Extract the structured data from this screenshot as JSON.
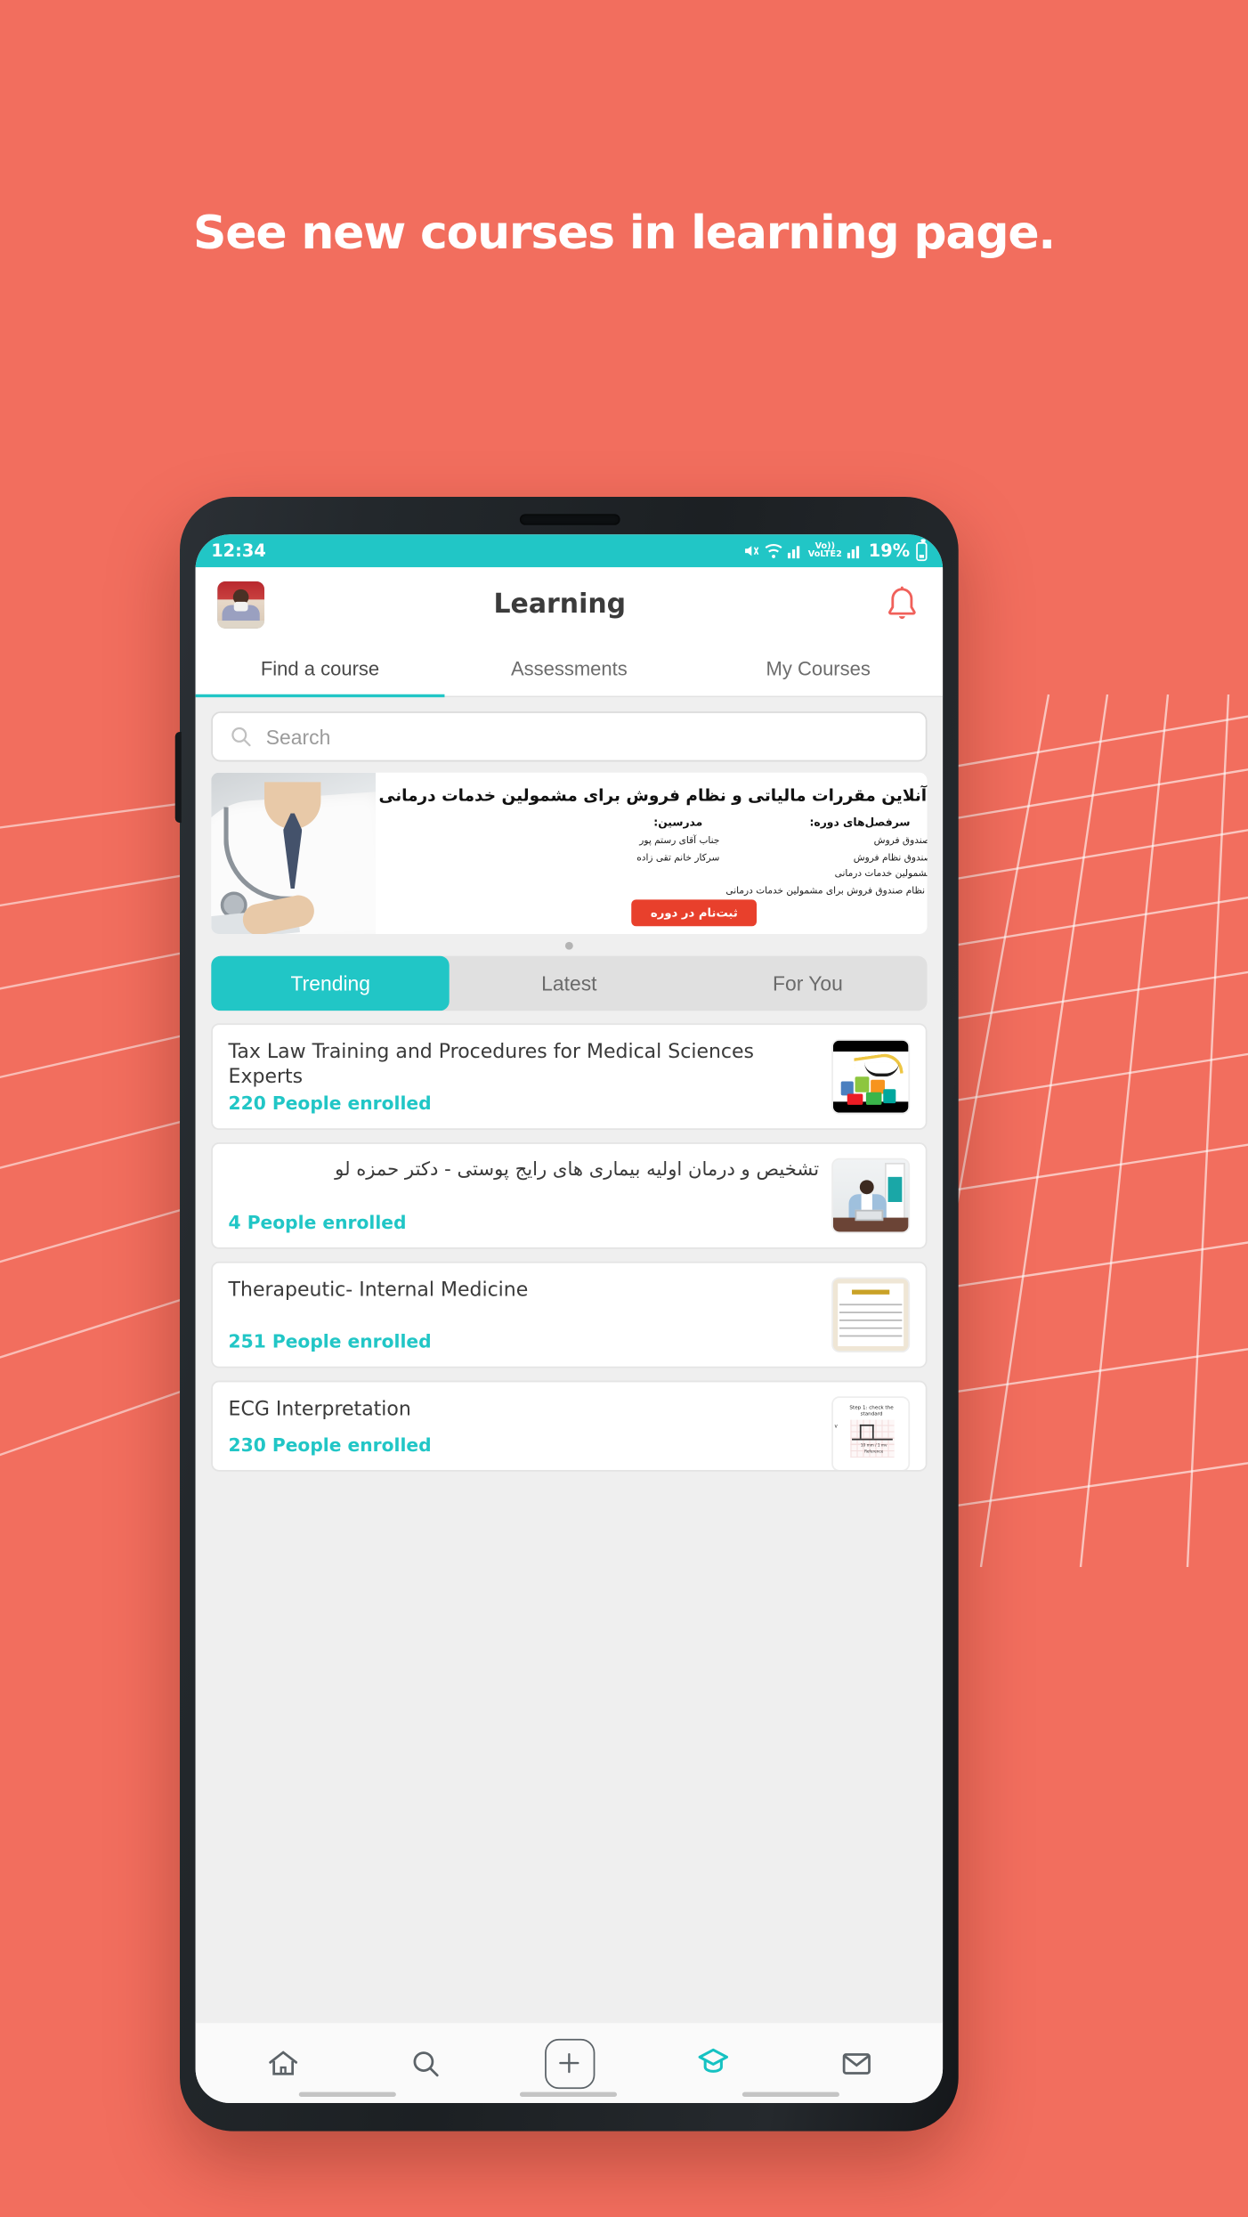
{
  "promo": {
    "headline": "See new courses in learning page.",
    "background_color": "#F26E5E",
    "accent_color": "#21C6C6"
  },
  "status_bar": {
    "time": "12:34",
    "network_label": "VoLTE2",
    "battery_percent": "19%",
    "icons": [
      "mute-icon",
      "wifi-icon",
      "signal-icon",
      "volte-icon",
      "signal-icon",
      "battery-icon"
    ]
  },
  "app_bar": {
    "title": "Learning",
    "avatar": "user-avatar",
    "notification_icon": "bell-icon"
  },
  "top_tabs": [
    {
      "label": "Find a course",
      "active": true
    },
    {
      "label": "Assessments",
      "active": false
    },
    {
      "label": "My Courses",
      "active": false
    }
  ],
  "search": {
    "placeholder": "Search",
    "value": "",
    "icon": "search-icon"
  },
  "banner": {
    "title": "آموزش آنلاین مقررات مالیاتی و نظام فروش برای مشمولین خدمات درمانی",
    "topics_heading": "سرفصل‌های دوره:",
    "topics": [
      "معرفی نظام صندوق فروش",
      "اجزای شبکه صندوق نظام فروش",
      "نحوه ثبت‌نام مشمولین خدمات درمانی",
      "قوانین اجرایی نظام صندوق فروش برای مشمولین خدمات درمانی"
    ],
    "instructors_heading": "مدرسین:",
    "instructors": [
      "جناب آقای رستم پور",
      "سرکار خانم تقی زاده"
    ],
    "cta_label": "ثبت‌نام در دوره",
    "cta_color": "#E8402C",
    "pager_dots": 1
  },
  "segments": [
    {
      "label": "Trending",
      "active": true
    },
    {
      "label": "Latest",
      "active": false
    },
    {
      "label": "For You",
      "active": false
    }
  ],
  "courses": [
    {
      "title": "Tax Law Training and Procedures for Medical Sciences Experts",
      "enrolled": "220 People enrolled",
      "rtl": false,
      "thumb": "tax-calligraphy-thumbnail"
    },
    {
      "title": "تشخیص و درمان اولیه بیماری های رایج پوستی - دکتر حمزه لو",
      "enrolled": "4 People enrolled",
      "rtl": true,
      "thumb": "lecturer-video-thumbnail"
    },
    {
      "title": "Therapeutic- Internal Medicine",
      "enrolled": "251 People enrolled",
      "rtl": false,
      "thumb": "document-thumbnail"
    },
    {
      "title": "ECG Interpretation",
      "enrolled": "230 People enrolled",
      "rtl": false,
      "thumb": "ecg-slide-thumbnail",
      "thumb_caption": "Step 1: check the standard",
      "thumb_subcaption": "10 mm / 1 mv Reference"
    }
  ],
  "bottom_nav": [
    {
      "icon": "home-icon",
      "active": false
    },
    {
      "icon": "search-icon",
      "active": false
    },
    {
      "icon": "plus-icon",
      "active": false
    },
    {
      "icon": "graduation-cap-icon",
      "active": true
    },
    {
      "icon": "mail-icon",
      "active": false
    }
  ]
}
